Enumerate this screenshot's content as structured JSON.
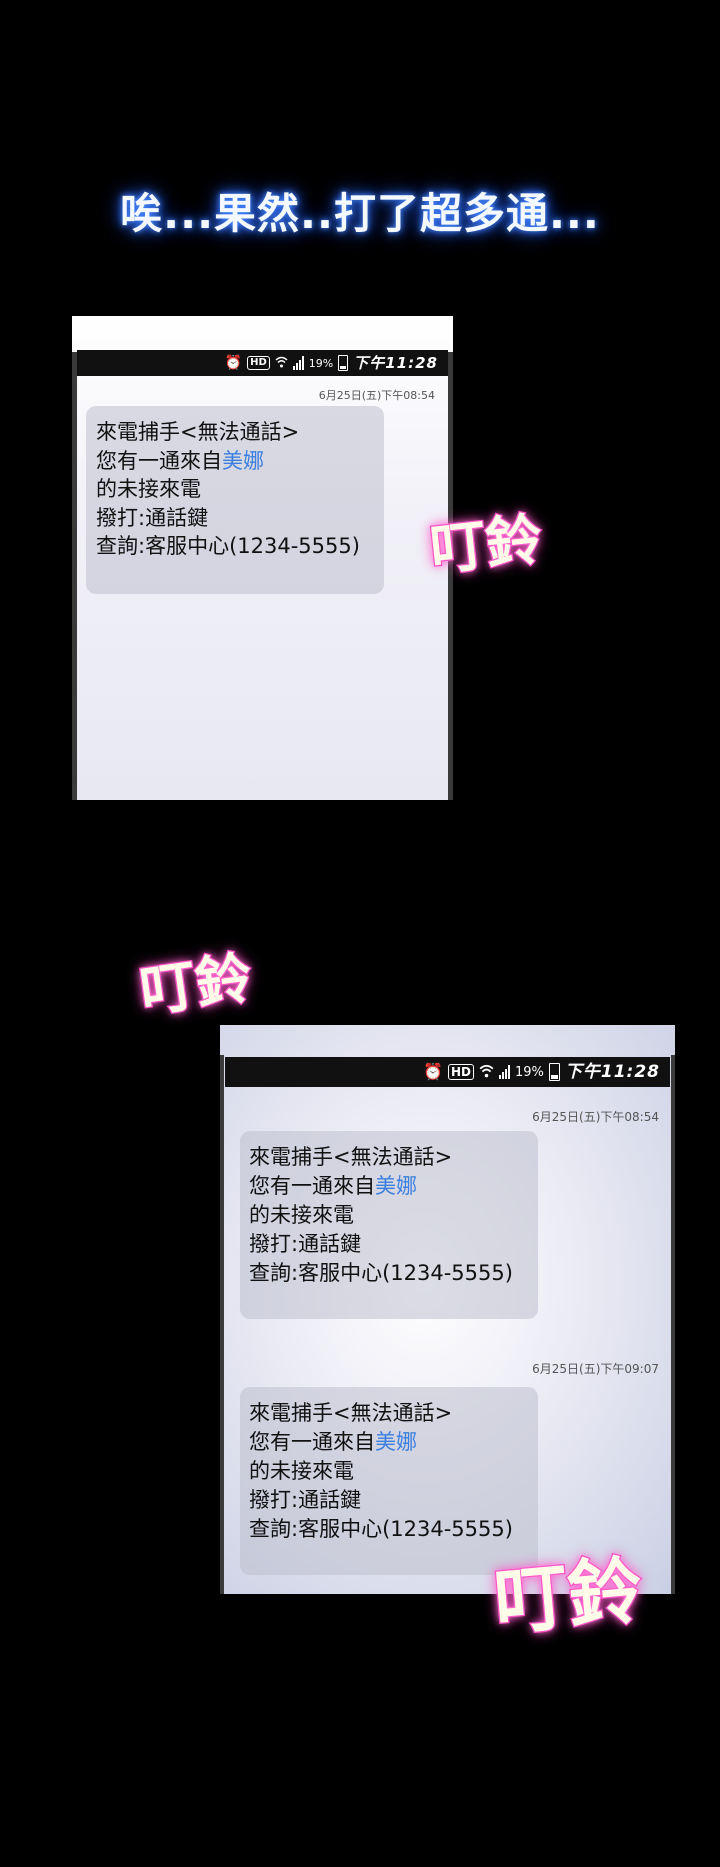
{
  "caption": "唉...果然..打了超多通...",
  "sound_effect": "叮鈴",
  "status_bar": {
    "battery_percent": "19%",
    "clock": "下午11:28",
    "hd_label": "HD",
    "icons": [
      "alarm-icon",
      "hd-icon",
      "wifi-icon",
      "signal-icon",
      "battery-icon"
    ]
  },
  "message": {
    "line1": "來電捕手<無法通話>",
    "line2_prefix": "您有一通來自",
    "contact": "美娜",
    "line3": "的未接來電",
    "line4": "撥打:通話鍵",
    "line5": "查詢:客服中心(1234-5555)"
  },
  "screens": [
    {
      "timestamps": [
        "6月25日(五)下午08:54"
      ]
    },
    {
      "timestamps": [
        "6月25日(五)下午08:54",
        "6月25日(五)下午09:07"
      ]
    }
  ],
  "colors": {
    "caption_glow": "#2d6bff",
    "sfx_outline": "#ff3fbf",
    "contact_name": "#3a7fe0",
    "background": "#000000"
  }
}
